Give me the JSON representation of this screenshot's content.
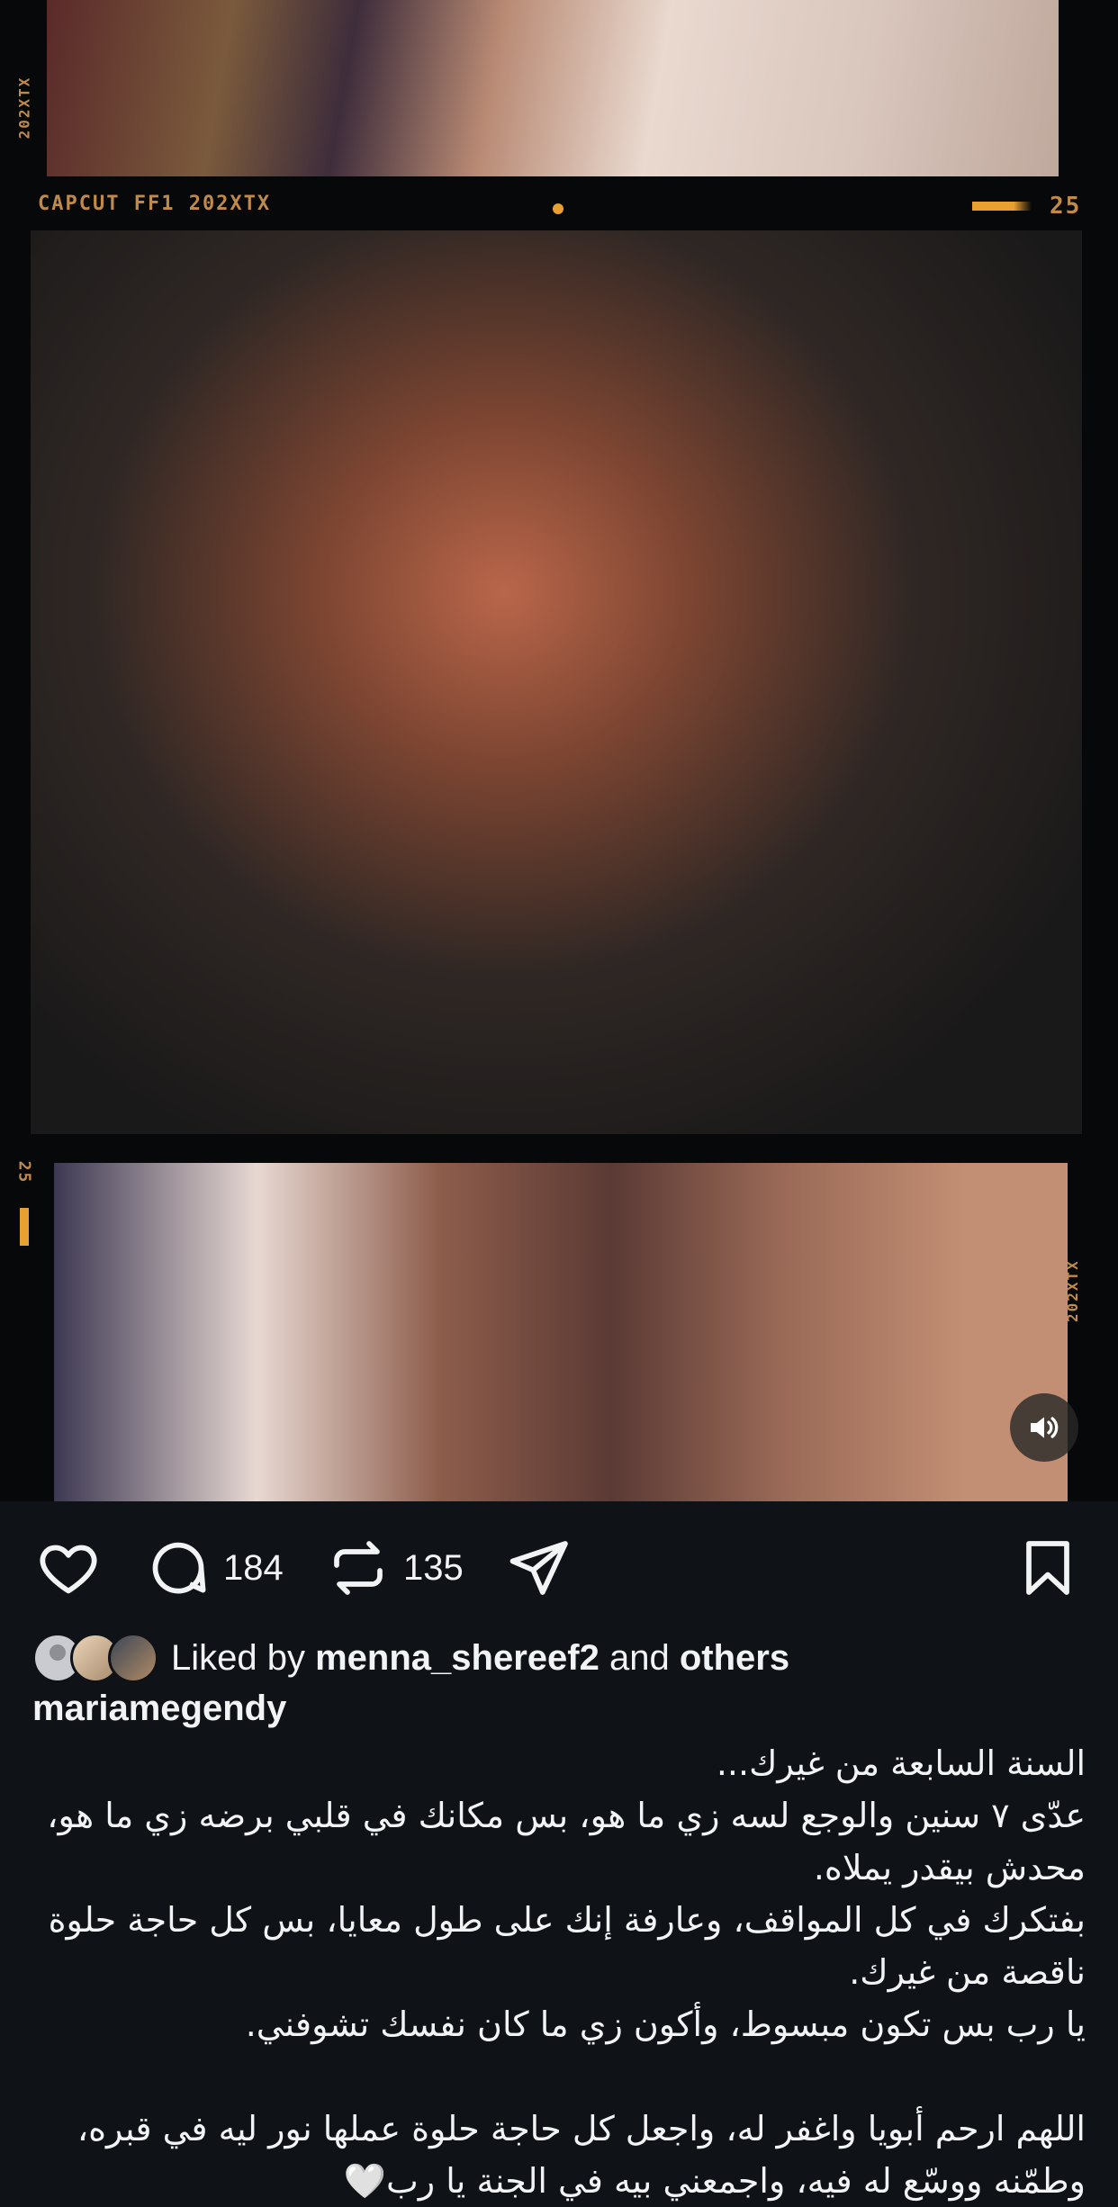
{
  "media": {
    "film_text_top": "CAPCUT   FF1 202XTX",
    "film_number_top": "25",
    "film_text_side_left": "202XTX",
    "film_text_side_right": "CAPCUT  FF1 202XTX",
    "film_number_side": "25",
    "sound_icon": "speaker-icon"
  },
  "actions": {
    "comments_count": "184",
    "reposts_count": "135"
  },
  "liked_by": {
    "prefix": "Liked by",
    "user": "menna_shereef2",
    "and": "and",
    "others": "others"
  },
  "post": {
    "username": "mariamegendy",
    "caption": "السنة السابعة من غيرك...\nعدّى ٧ سنين والوجع لسه زي ما هو، بس مكانك في قلبي برضه زي ما هو، محدش بيقدر يملاه.\nبفتكرك في كل المواقف، وعارفة إنك على طول معايا، بس كل حاجة حلوة ناقصة من غيرك.\nيا رب بس تكون مبسوط، وأكون زي ما كان نفسك تشوفني.\n\nاللهم ارحم أبويا واغفر له، واجعل كل حاجة حلوة عملها نور ليه في قبره، وطمّنه ووسّع له فيه، واجمعني بيه في الجنة يا رب🤍"
  },
  "colors": {
    "background": "#0f1217",
    "text": "#f2f3f5",
    "film_accent": "#c08a4a"
  }
}
